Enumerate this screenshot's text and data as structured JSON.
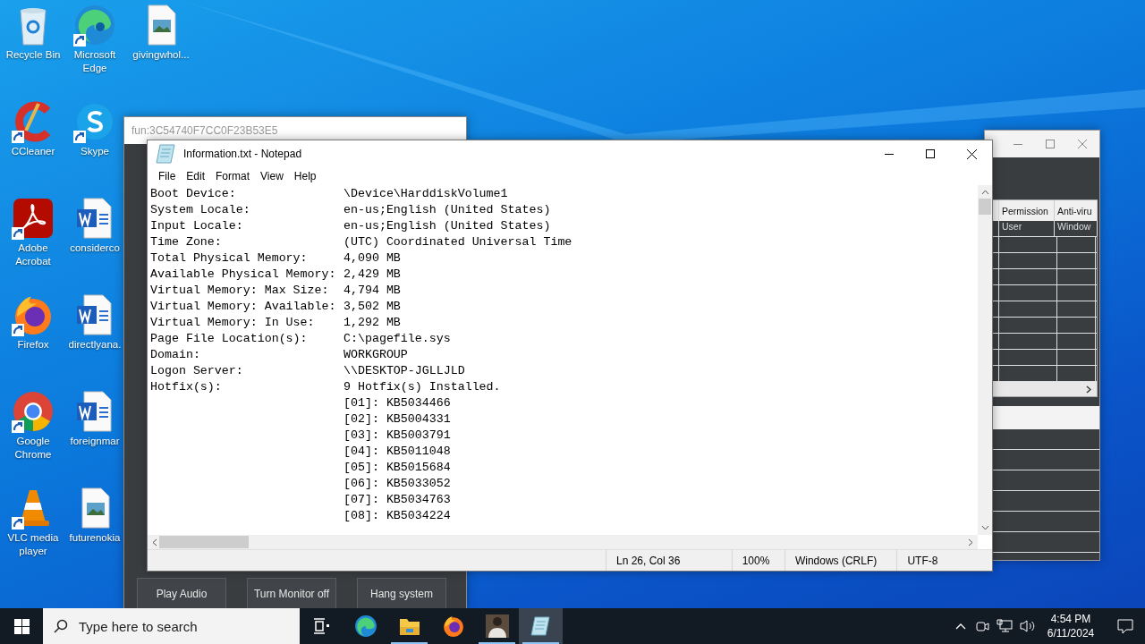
{
  "desktop_icons": [
    {
      "label": "Recycle Bin",
      "kind": "recycle",
      "shortcut": false
    },
    {
      "label": "CCleaner",
      "kind": "ccleaner",
      "shortcut": true
    },
    {
      "label": "Adobe Acrobat",
      "kind": "pdf",
      "shortcut": true
    },
    {
      "label": "Firefox",
      "kind": "firefox",
      "shortcut": true
    },
    {
      "label": "Google Chrome",
      "kind": "chrome",
      "shortcut": true
    },
    {
      "label": "VLC media player",
      "kind": "vlc",
      "shortcut": true
    },
    {
      "label": "Microsoft Edge",
      "kind": "edge",
      "shortcut": true
    },
    {
      "label": "Skype",
      "kind": "skype",
      "shortcut": true
    },
    {
      "label": "considerco",
      "kind": "word",
      "shortcut": false
    },
    {
      "label": "directlyana.",
      "kind": "word",
      "shortcut": false
    },
    {
      "label": "foreignmar",
      "kind": "word",
      "shortcut": false
    },
    {
      "label": "futurenokia",
      "kind": "image",
      "shortcut": false
    },
    {
      "label": "givingwhol...",
      "kind": "image",
      "shortcut": false
    }
  ],
  "back_window": {
    "title": "fun:3C54740F7CC0F23B53E5",
    "buttons": [
      "Play Audio",
      "Turn Monitor off",
      "Hang system"
    ]
  },
  "right_window": {
    "columns": [
      "Permission",
      "Anti-viru"
    ],
    "rows": [
      [
        "User",
        "Window"
      ]
    ]
  },
  "notepad": {
    "title": "Information.txt - Notepad",
    "menu": [
      "File",
      "Edit",
      "Format",
      "View",
      "Help"
    ],
    "lines": [
      {
        "label": "Boot Device:",
        "value": "\\Device\\HarddiskVolume1"
      },
      {
        "label": "System Locale:",
        "value": "en-us;English (United States)"
      },
      {
        "label": "Input Locale:",
        "value": "en-us;English (United States)"
      },
      {
        "label": "Time Zone:",
        "value": "(UTC) Coordinated Universal Time"
      },
      {
        "label": "Total Physical Memory:",
        "value": "4,090 MB"
      },
      {
        "label": "Available Physical Memory:",
        "value": "2,429 MB"
      },
      {
        "label": "Virtual Memory: Max Size:",
        "value": "4,794 MB"
      },
      {
        "label": "Virtual Memory: Available:",
        "value": "3,502 MB"
      },
      {
        "label": "Virtual Memory: In Use:",
        "value": "1,292 MB"
      },
      {
        "label": "Page File Location(s):",
        "value": "C:\\pagefile.sys"
      },
      {
        "label": "Domain:",
        "value": "WORKGROUP"
      },
      {
        "label": "Logon Server:",
        "value": "\\\\DESKTOP-JGLLJLD"
      },
      {
        "label": "Hotfix(s):",
        "value": "9 Hotfix(s) Installed."
      },
      {
        "value": "[01]: KB5034466"
      },
      {
        "value": "[02]: KB5004331"
      },
      {
        "value": "[03]: KB5003791"
      },
      {
        "value": "[04]: KB5011048"
      },
      {
        "value": "[05]: KB5015684"
      },
      {
        "value": "[06]: KB5033052"
      },
      {
        "value": "[07]: KB5034763"
      },
      {
        "value": "[08]: KB5034224"
      }
    ],
    "status": [
      "Ln 26, Col 36",
      "100%",
      "Windows (CRLF)",
      "UTF-8"
    ]
  },
  "taskbar": {
    "search_placeholder": "Type here to search",
    "apps": [
      {
        "kind": "taskview",
        "running": false,
        "selected": false
      },
      {
        "kind": "edge",
        "running": false,
        "selected": false
      },
      {
        "kind": "explorer",
        "running": true,
        "selected": false
      },
      {
        "kind": "firefox",
        "running": false,
        "selected": false
      },
      {
        "kind": "figure",
        "running": true,
        "selected": false
      },
      {
        "kind": "notepad",
        "running": true,
        "selected": true
      }
    ],
    "time": "4:54 PM",
    "date": "6/11/2024"
  }
}
